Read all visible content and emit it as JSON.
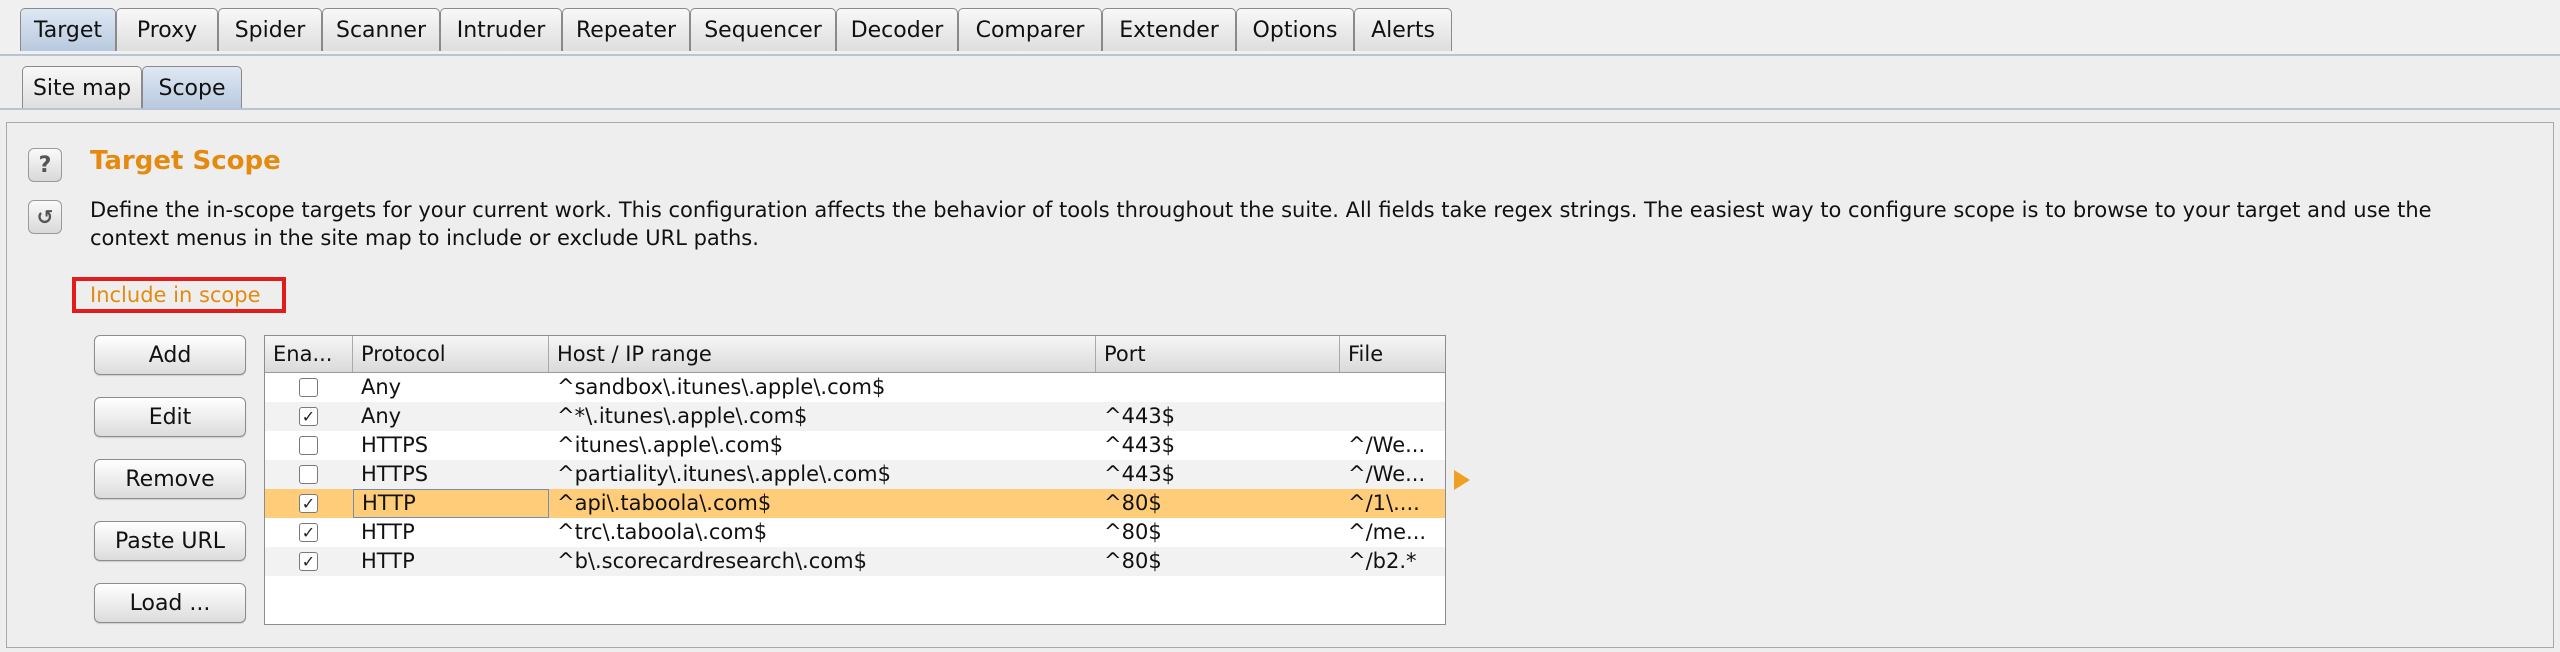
{
  "top_tabs": [
    "Target",
    "Proxy",
    "Spider",
    "Scanner",
    "Intruder",
    "Repeater",
    "Sequencer",
    "Decoder",
    "Comparer",
    "Extender",
    "Options",
    "Alerts"
  ],
  "sub_tabs": [
    "Site map",
    "Scope"
  ],
  "section": {
    "title": "Target Scope",
    "description": "Define the in-scope targets for your current work. This configuration affects the behavior of tools throughout the suite. All fields take regex strings. The easiest way to configure scope is to browse to your target and use the context menus in the site map to include or exclude URL paths.",
    "include_label": "Include in scope"
  },
  "buttons": [
    "Add",
    "Edit",
    "Remove",
    "Paste URL",
    "Load ..."
  ],
  "table": {
    "columns": [
      "Ena...",
      "Protocol",
      "Host / IP range",
      "Port",
      "File"
    ],
    "rows": [
      {
        "enabled": false,
        "checkmark": "",
        "protocol": "Any",
        "host": "^sandbox\\.itunes\\.apple\\.com$",
        "port": "",
        "file": ""
      },
      {
        "enabled": true,
        "checkmark": "✓",
        "protocol": "Any",
        "host": "^*\\.itunes\\.apple\\.com$",
        "port": "^443$",
        "file": ""
      },
      {
        "enabled": false,
        "checkmark": "",
        "protocol": "HTTPS",
        "host": "^itunes\\.apple\\.com$",
        "port": "^443$",
        "file": "^/We..."
      },
      {
        "enabled": false,
        "checkmark": "",
        "protocol": "HTTPS",
        "host": "^partiality\\.itunes\\.apple\\.com$",
        "port": "^443$",
        "file": "^/We..."
      },
      {
        "enabled": true,
        "checkmark": "✓",
        "protocol": "HTTP",
        "host": "^api\\.taboola\\.com$",
        "port": "^80$",
        "file": "^/1\\...."
      },
      {
        "enabled": true,
        "checkmark": "✓",
        "protocol": "HTTP",
        "host": "^trc\\.taboola\\.com$",
        "port": "^80$",
        "file": "^/me..."
      },
      {
        "enabled": true,
        "checkmark": "✓",
        "protocol": "HTTP",
        "host": "^b\\.scorecardresearch\\.com$",
        "port": "^80$",
        "file": "^/b2.*"
      }
    ]
  },
  "icons": {
    "help": "?",
    "refresh": "↺"
  },
  "colors": {
    "accent": "#e58a0f",
    "selected_row": "#ffcd7a",
    "highlight_box": "#e41b1b"
  }
}
